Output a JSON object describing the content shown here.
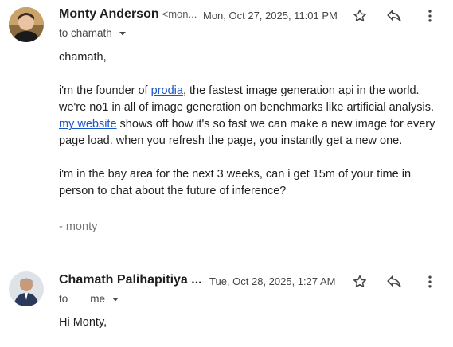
{
  "messages": [
    {
      "sender_name": "Monty Anderson",
      "sender_email": "<mon...",
      "date": "Mon, Oct 27, 2025, 11:01 PM",
      "to_label": "to chamath",
      "body": {
        "salutation": "chamath,",
        "p1_a": "i'm the founder of ",
        "p1_link": "prodia",
        "p1_b": ", the fastest image generation api in the world. we're no1 in all of image generation on benchmarks like artificial analysis. ",
        "p1_link2": "my website",
        "p1_c": " shows off how it's so fast we can make a new image for every page load. when you refresh the page, you instantly get a new one.",
        "p2": "i'm in the bay area for the next 3 weeks, can i get 15m of your time in person to chat about the future of inference?",
        "signature": "- monty"
      }
    },
    {
      "sender_name": "Chamath Palihapitiya ...",
      "date": "Tue, Oct 28, 2025, 1:27 AM",
      "to_prefix": "to",
      "to_recipient": "me",
      "greeting": "Hi Monty,"
    }
  ],
  "icons": {
    "star": "star-icon",
    "reply": "reply-icon",
    "more": "more-vert-icon",
    "caret": "caret-down-icon"
  },
  "colors": {
    "link": "#1a55c8",
    "muted": "#444746"
  }
}
